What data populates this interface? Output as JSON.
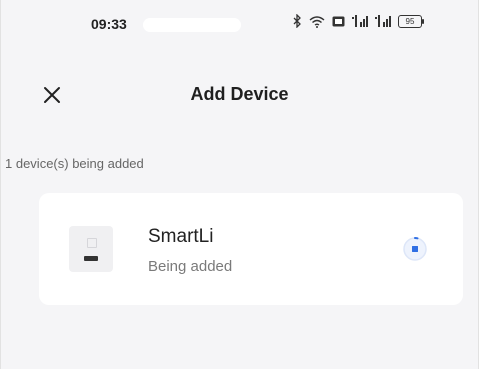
{
  "status_bar": {
    "time": "09:33",
    "battery": "95",
    "icons": [
      "bluetooth-icon",
      "wifi-icon",
      "nfc-icon",
      "signal-icon-1",
      "signal-icon-2",
      "battery-icon"
    ]
  },
  "header": {
    "title": "Add Device",
    "close_icon": "close-icon"
  },
  "devices_section": {
    "count_label": "1 device(s) being added"
  },
  "device": {
    "name": "SmartLi",
    "status": "Being added",
    "progress_icon": "loading-spinner-icon"
  },
  "colors": {
    "background": "#f5f5f7",
    "card": "#ffffff",
    "accent": "#2f6fe4",
    "text_primary": "#1f1f1f",
    "text_secondary": "#7a7a7a"
  }
}
